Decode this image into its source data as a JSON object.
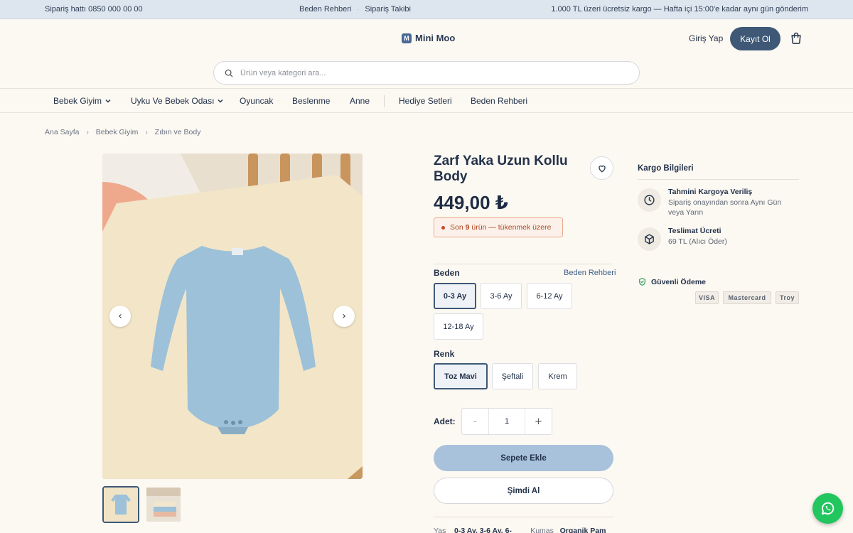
{
  "topbar": {
    "phone": "Sipariş hattı 0850 000 00 00",
    "links": [
      "Beden Rehberi",
      "Sipariş Takibi"
    ],
    "promo": "1.000 TL üzeri ücretsiz kargo — Hafta içi 15:00'e kadar aynı gün gönderim"
  },
  "header": {
    "logo_letter": "M",
    "logo": "Mini Moo",
    "login": "Giriş Yap",
    "register": "Kayıt Ol",
    "search_placeholder": "Ürün veya kategori ara..."
  },
  "nav": {
    "items": [
      "Bebek Giyim",
      "Uyku Ve Bebek Odası",
      "Oyuncak",
      "Beslenme",
      "Anne",
      "Hediye Setleri",
      "Beden Rehberi"
    ]
  },
  "breadcrumb": [
    "Ana Sayfa",
    "Bebek Giyim",
    "Zıbın ve Body"
  ],
  "product": {
    "title": "Zarf Yaka Uzun Kollu Body",
    "price": "449,00 ₺",
    "stock_prefix": "Son ",
    "stock_count": "9",
    "stock_suffix": " ürün — tükenmek üzere",
    "size_label": "Beden",
    "size_guide": "Beden Rehberi",
    "sizes": [
      "0-3 Ay",
      "3-6 Ay",
      "6-12 Ay",
      "12-18 Ay"
    ],
    "selected_size": "0-3 Ay",
    "color_label": "Renk",
    "colors": [
      "Toz Mavi",
      "Şeftali",
      "Krem"
    ],
    "selected_color": "Toz Mavi",
    "qty_label": "Adet:",
    "qty_minus": "-",
    "qty_plus": "+",
    "qty": "1",
    "add_to_cart": "Sepete Ekle",
    "buy_now": "Şimdi Al",
    "specs": {
      "age_label": "Yaş",
      "age_value": "0-3 Ay, 3-6 Ay, 6-",
      "fabric_label": "Kumaş",
      "fabric_value": "Organik Pam"
    }
  },
  "shipping": {
    "title": "Kargo Bilgileri",
    "items": [
      {
        "heading": "Tahmini Kargoya Veriliş",
        "text": "Sipariş onayından sonra Aynı Gün veya Yarın",
        "icon": "clock-icon"
      },
      {
        "heading": "Teslimat Ücreti",
        "text": "69 TL (Alıcı Öder)",
        "icon": "box-icon"
      }
    ],
    "secure": "Güvenli Ödeme",
    "payments": [
      "VISA",
      "Mastercard",
      "Troy"
    ]
  },
  "colors": {
    "primary": "#3e5876",
    "add_to_cart_bg": "#a9c2dc",
    "whatsapp": "#22c55e",
    "stock_warning": "#b14b24"
  }
}
